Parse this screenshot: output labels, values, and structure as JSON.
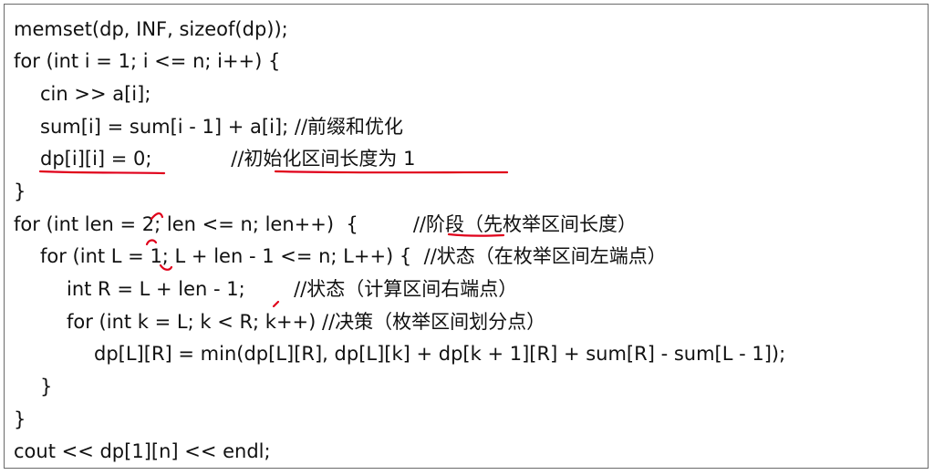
{
  "code": {
    "lines": [
      "memset(dp, INF, sizeof(dp));",
      "for (int i = 1; i <= n; i++) {",
      "cin >> a[i];",
      "sum[i] = sum[i - 1] + a[i]; //前缀和优化",
      "dp[i][i] = 0;             //初始化区间长度为 1",
      "}",
      "for (int len = 2; len <= n; len++)  {         //阶段（先枚举区间长度）",
      "for (int L = 1; L + len - 1 <= n; L++) {  //状态（在枚举区间左端点）",
      "int R = L + len - 1;        //状态（计算区间右端点）",
      "for (int k = L; k < R; k++) //决策（枚举区间划分点）",
      "dp[L][R] = min(dp[L][R], dp[L][k] + dp[k + 1][R] + sum[R] - sum[L - 1]);",
      "}",
      "}",
      "cout << dp[1][n] << endl;"
    ]
  },
  "colors": {
    "border": "#6a6a6a",
    "text": "#111111",
    "annotation": "#e0001a"
  }
}
